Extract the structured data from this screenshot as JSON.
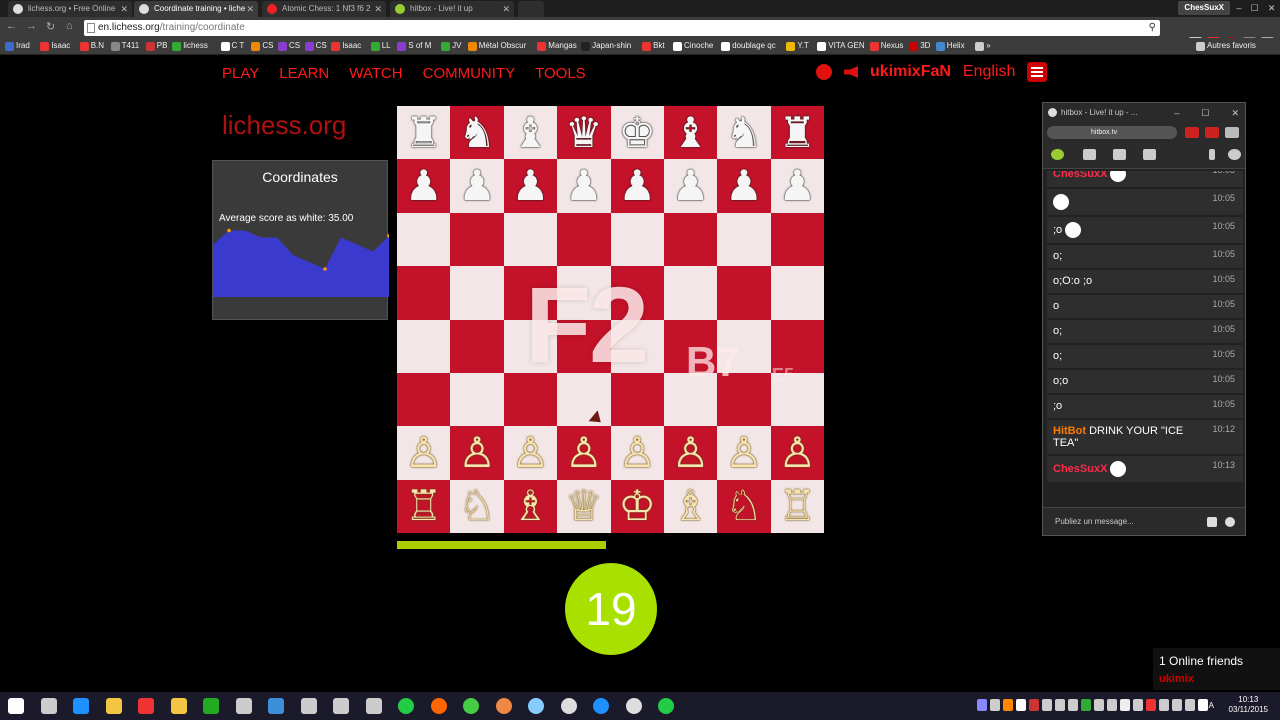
{
  "browser": {
    "tabs": [
      {
        "label": "lichess.org • Free Online",
        "active": false
      },
      {
        "label": "Coordinate training • liche",
        "active": true
      },
      {
        "label": "Atomic Chess: 1 Nf3 f6 2",
        "active": false
      },
      {
        "label": "hitbox - Live! it up",
        "active": false
      }
    ],
    "user_badge": "ChesSuxX",
    "url_host": "en.lichess.org",
    "url_path": "/training/coordinate",
    "bookmarks": [
      "Irad",
      "Isaac",
      "B.N",
      "T411",
      "PB",
      "lichess",
      "C T",
      "CS",
      "CS",
      "CS",
      "Isaac",
      "LL",
      "S of M",
      "JV",
      "Métal Obscur",
      "Mangas",
      "Japan-shin",
      "Bkt",
      "Cinoche",
      "doublage qc",
      "Y.T",
      "VITA GEN",
      "Nexus",
      "3D",
      "Helix",
      "»",
      "Autres favoris"
    ]
  },
  "site": {
    "nav": [
      "PLAY",
      "LEARN",
      "WATCH",
      "COMMUNITY",
      "TOOLS"
    ],
    "username": "ukimixFaN",
    "language": "English",
    "logo": "lichess.org"
  },
  "coordinates_panel": {
    "title": "Coordinates",
    "average_label": "Average score as white: 35.00",
    "history": [
      30,
      38,
      38,
      34,
      34,
      24,
      20,
      16,
      34,
      30,
      26,
      35
    ]
  },
  "board": {
    "current_coord": "F2",
    "next_coord": "B7",
    "next2_coord": "E5",
    "rows": [
      [
        "♜",
        "♞",
        "♝",
        "♛",
        "♚",
        "♝",
        "♞",
        "♜"
      ],
      [
        "♟",
        "♟",
        "♟",
        "♟",
        "♟",
        "♟",
        "♟",
        "♟"
      ],
      [
        "",
        "",
        "",
        "",
        "",
        "",
        "",
        ""
      ],
      [
        "",
        "",
        "",
        "",
        "",
        "",
        "",
        ""
      ],
      [
        "",
        "",
        "",
        "",
        "",
        "",
        "",
        ""
      ],
      [
        "",
        "",
        "",
        "",
        "",
        "",
        "",
        ""
      ],
      [
        "♙",
        "♙",
        "♙",
        "♙",
        "♙",
        "♙",
        "♙",
        "♙"
      ],
      [
        "♖",
        "♘",
        "♗",
        "♕",
        "♔",
        "♗",
        "♘",
        "♖"
      ]
    ],
    "progress_fraction": 0.49,
    "timer": "19"
  },
  "popup": {
    "title": "hitbox - Live! it up - ...",
    "address": "hitbox.tv",
    "messages": [
      {
        "user": "ChesSuxX",
        "text": "",
        "time": "10:05"
      },
      {
        "user": "",
        "text": "",
        "time": "10:05"
      },
      {
        "user": "",
        "text": ";o",
        "time": "10:05"
      },
      {
        "user": "",
        "text": "o;",
        "time": "10:05"
      },
      {
        "user": "",
        "text": "o;O:o ;o",
        "time": "10:05"
      },
      {
        "user": "",
        "text": "o",
        "time": "10:05"
      },
      {
        "user": "",
        "text": "o;",
        "time": "10:05"
      },
      {
        "user": "",
        "text": "o;",
        "time": "10:05"
      },
      {
        "user": "",
        "text": "o;o",
        "time": "10:05"
      },
      {
        "user": "",
        "text": ";o",
        "time": "10:05"
      },
      {
        "user": "HitBot",
        "text": "DRINK YOUR \"ICE TEA\"",
        "time": "10:12"
      },
      {
        "user": "ChesSuxX",
        "text": "",
        "time": "10:13"
      }
    ],
    "input_placeholder": "Publiez un message..."
  },
  "friends": {
    "count_label": "1 Online friends",
    "name": "ukimix"
  },
  "taskbar": {
    "lang": "FRA",
    "time": "10:13",
    "date": "03/11/2015"
  }
}
